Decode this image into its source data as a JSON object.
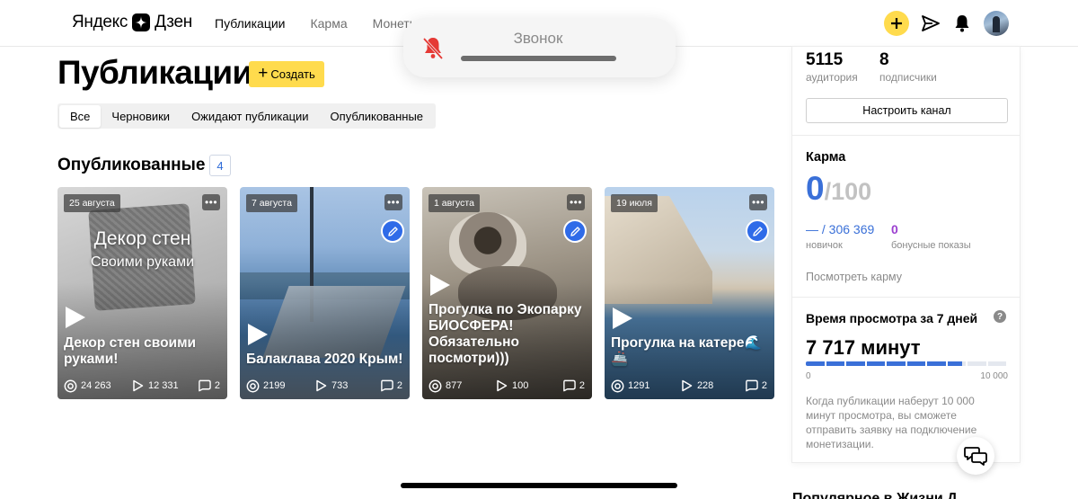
{
  "header": {
    "logo_text": "Яндекс",
    "logo_text_2": "Дзен",
    "nav": [
      {
        "label": "Публикации"
      },
      {
        "label": "Карма"
      },
      {
        "label": "Монетиза"
      }
    ]
  },
  "call_overlay": {
    "title": "Звонок"
  },
  "main": {
    "page_title": "Публикации",
    "create_label": "Создать",
    "tabs": [
      {
        "label": "Все"
      },
      {
        "label": "Черновики"
      },
      {
        "label": "Ожидают публикации"
      },
      {
        "label": "Опубликованные"
      }
    ],
    "section_title": "Опубликованные",
    "section_count": "4"
  },
  "cards": [
    {
      "date": "25 августа",
      "overlay_line1": "Декор стен",
      "overlay_line2": "Своими руками",
      "title": "Декор стен своими руками!",
      "views": "24 263",
      "plays": "12 331",
      "comments": "2",
      "has_edit": false
    },
    {
      "date": "7 августа",
      "title": "Балаклава 2020 Крым!",
      "views": "2199",
      "plays": "733",
      "comments": "2",
      "has_edit": true
    },
    {
      "date": "1 августа",
      "title": "Прогулка по Экопарку БИОСФЕРА! Обязательно посмотри)))",
      "views": "877",
      "plays": "100",
      "comments": "2",
      "has_edit": true
    },
    {
      "date": "19 июля",
      "title": "Прогулка на катере🌊🚢",
      "views": "1291",
      "plays": "228",
      "comments": "2",
      "has_edit": true
    }
  ],
  "right_panel": {
    "audience_value": "5115",
    "audience_label": "аудитория",
    "subscribers_value": "8",
    "subscribers_label": "подписчики",
    "setup_button": "Настроить канал",
    "karma_title": "Карма",
    "karma_value": "0",
    "karma_max": "/100",
    "rank_value": "— / 306 369",
    "rank_label": "новичок",
    "bonus_value": "0",
    "bonus_label": "бонусные показы",
    "karma_link": "Посмотреть карму",
    "watch_title": "Время просмотра за 7 дней",
    "watch_value": "7 717 минут",
    "watch_progress": 0.7717,
    "progress_min": "0",
    "progress_max": "10 000",
    "monetization_note": "Когда публикации наберут 10 000 минут просмотра, вы сможете отправить заявку на подключение монетизации."
  },
  "bottom_peek": "Популярное в Жизни Д",
  "colors": {
    "accent_yellow": "#ffdb4d",
    "accent_blue": "#3a70d8",
    "edit_blue": "#2f6be8",
    "bonus_purple": "#9b3fd0",
    "muted_bell_red": "#e53935"
  }
}
